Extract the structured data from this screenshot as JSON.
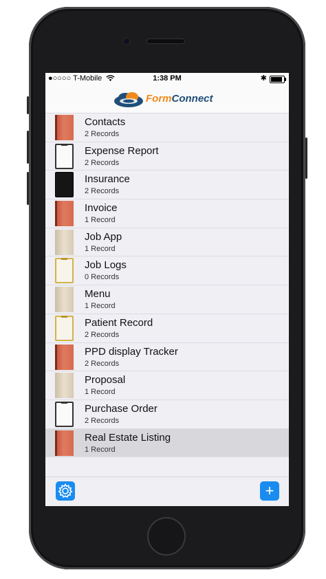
{
  "status_bar": {
    "carrier": "●○○○○ T-Mobile",
    "time": "1:38 PM",
    "bluetooth": "✱"
  },
  "header": {
    "logo_form": "Form",
    "logo_connect": "Connect"
  },
  "forms": [
    {
      "name": "Contacts",
      "records": "2 Records",
      "icon": "red-notebook-icon"
    },
    {
      "name": "Expense Report",
      "records": "2 Records",
      "icon": "clipboard-icon"
    },
    {
      "name": "Insurance",
      "records": "2 Records",
      "icon": "black-book-icon"
    },
    {
      "name": "Invoice",
      "records": "1 Record",
      "icon": "red-notebook-icon"
    },
    {
      "name": "Job App",
      "records": "1 Record",
      "icon": "beige-folder-icon"
    },
    {
      "name": "Job Logs",
      "records": "0 Records",
      "icon": "gold-clipboard-icon"
    },
    {
      "name": "Menu",
      "records": "1 Record",
      "icon": "beige-folder-icon"
    },
    {
      "name": "Patient Record",
      "records": "2 Records",
      "icon": "gold-clipboard-icon"
    },
    {
      "name": "PPD display Tracker",
      "records": "2 Records",
      "icon": "red-notebook-icon"
    },
    {
      "name": "Proposal",
      "records": "1 Record",
      "icon": "beige-folder-icon"
    },
    {
      "name": "Purchase Order",
      "records": "2 Records",
      "icon": "clipboard-icon"
    },
    {
      "name": "Real Estate Listing",
      "records": "1 Record",
      "icon": "red-notebook-icon"
    }
  ],
  "selected_index": 11,
  "toolbar": {
    "settings_icon": "gear-icon",
    "add_icon": "plus-icon",
    "add_symbol": "+"
  },
  "colors": {
    "accent": "#1a8cf0",
    "brand_orange": "#f08a1c",
    "brand_blue": "#1f4e79"
  }
}
